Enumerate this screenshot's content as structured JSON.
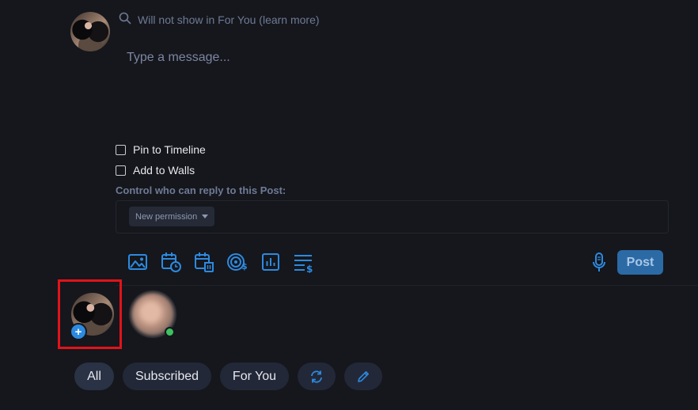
{
  "composer": {
    "visibility_note": "Will not show in For You (learn more)",
    "message_placeholder": "Type a message..."
  },
  "options": {
    "pin_label": "Pin to Timeline",
    "walls_label": "Add to Walls",
    "reply_control_label": "Control who can reply to this Post:",
    "permission_button": "New permission"
  },
  "toolbar": {
    "icons": [
      "image-icon",
      "schedule-icon",
      "expiring-post-icon",
      "tip-goal-icon",
      "poll-icon",
      "price-list-icon"
    ],
    "mic_icon": "microphone-icon",
    "post_label": "Post"
  },
  "stories": {
    "self_badge": "+"
  },
  "feed_tabs": {
    "all": "All",
    "subscribed": "Subscribed",
    "for_you": "For You",
    "refresh_icon": "refresh-icon",
    "edit_icon": "pencil-icon"
  },
  "colors": {
    "background": "#15171c",
    "accent": "#2d8ae0",
    "post_button": "#2c6aa6",
    "highlight_box": "#e1131a",
    "online": "#3cc25f"
  }
}
